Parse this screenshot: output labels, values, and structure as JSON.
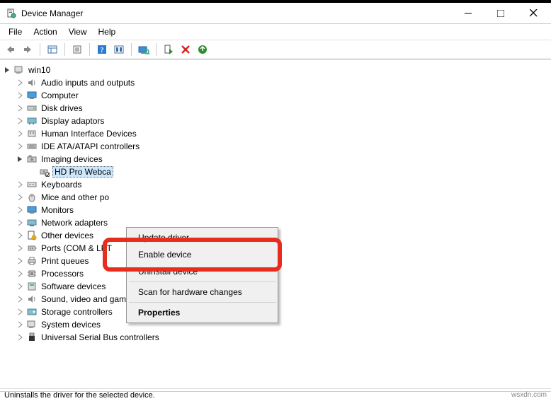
{
  "window": {
    "title": "Device Manager"
  },
  "menu": {
    "file": "File",
    "action": "Action",
    "view": "View",
    "help": "Help"
  },
  "tree": {
    "root": "win10",
    "items": [
      {
        "label": "Audio inputs and outputs"
      },
      {
        "label": "Computer"
      },
      {
        "label": "Disk drives"
      },
      {
        "label": "Display adaptors"
      },
      {
        "label": "Human Interface Devices"
      },
      {
        "label": "IDE ATA/ATAPI controllers"
      },
      {
        "label": "Imaging devices",
        "expanded": true
      },
      {
        "label": "HD Pro Webca",
        "selected": true,
        "child": true
      },
      {
        "label": "Keyboards"
      },
      {
        "label": "Mice and other po"
      },
      {
        "label": "Monitors"
      },
      {
        "label": "Network adapters"
      },
      {
        "label": "Other devices"
      },
      {
        "label": "Ports (COM & LPT"
      },
      {
        "label": "Print queues"
      },
      {
        "label": "Processors"
      },
      {
        "label": "Software devices"
      },
      {
        "label": "Sound, video and game controllers"
      },
      {
        "label": "Storage controllers"
      },
      {
        "label": "System devices"
      },
      {
        "label": "Universal Serial Bus controllers"
      }
    ]
  },
  "context": {
    "update": "Update driver",
    "enable": "Enable device",
    "uninstall": "Uninstall device",
    "scan": "Scan for hardware changes",
    "properties": "Properties"
  },
  "status": {
    "text": "Uninstalls the driver for the selected device."
  },
  "watermark": "wsxdn.com"
}
